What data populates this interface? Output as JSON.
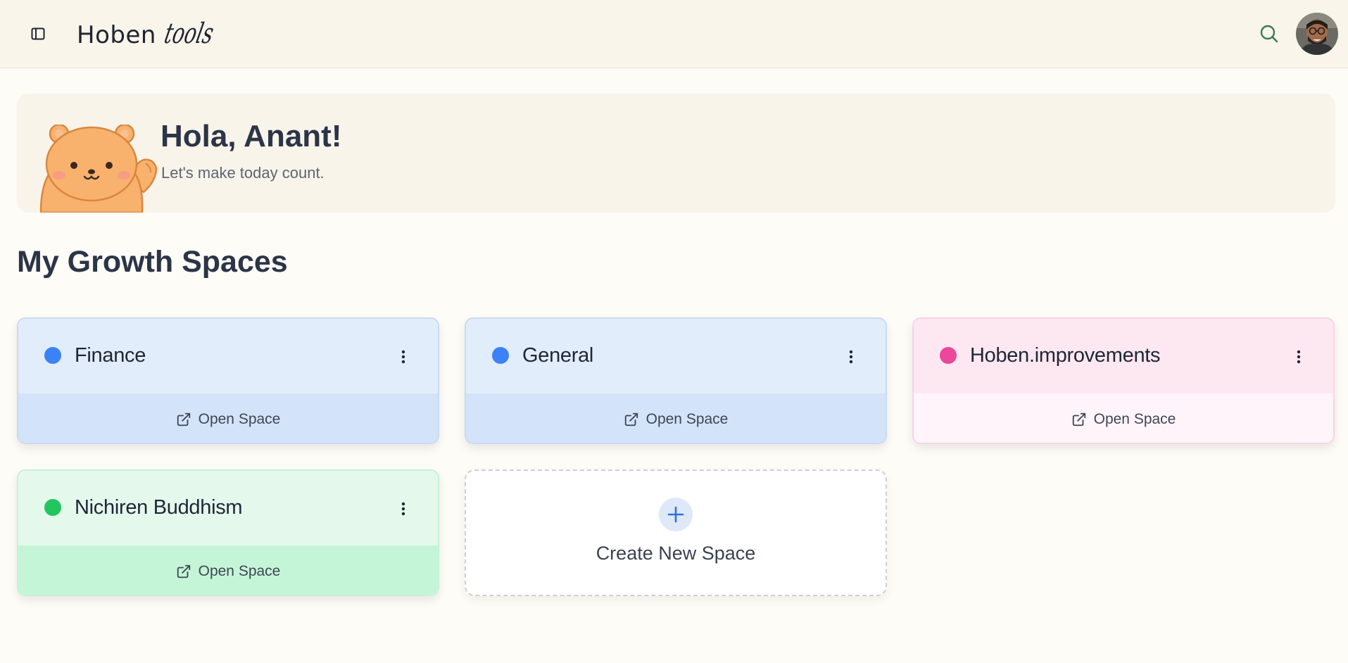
{
  "header": {
    "logo_main": "Hoben",
    "logo_script": "tools",
    "sidebar_toggle_icon": "sidebar-toggle-icon",
    "search_icon": "search-icon",
    "search_color": "#3d7a5a",
    "avatar_icon": "user-avatar"
  },
  "greeting": {
    "title": "Hola, Anant!",
    "subtitle": "Let's make today count.",
    "illustration": "waving-bear"
  },
  "spaces_section": {
    "title": "My Growth Spaces",
    "open_label": "Open Space",
    "create_label": "Create New Space",
    "spaces": [
      {
        "name": "Finance",
        "color": "#3b82f6"
      },
      {
        "name": "General",
        "color": "#3b82f6"
      },
      {
        "name": "Hoben.improvements",
        "color": "#ec4899"
      },
      {
        "name": "Nichiren Buddhism",
        "color": "#22c55e"
      }
    ]
  }
}
